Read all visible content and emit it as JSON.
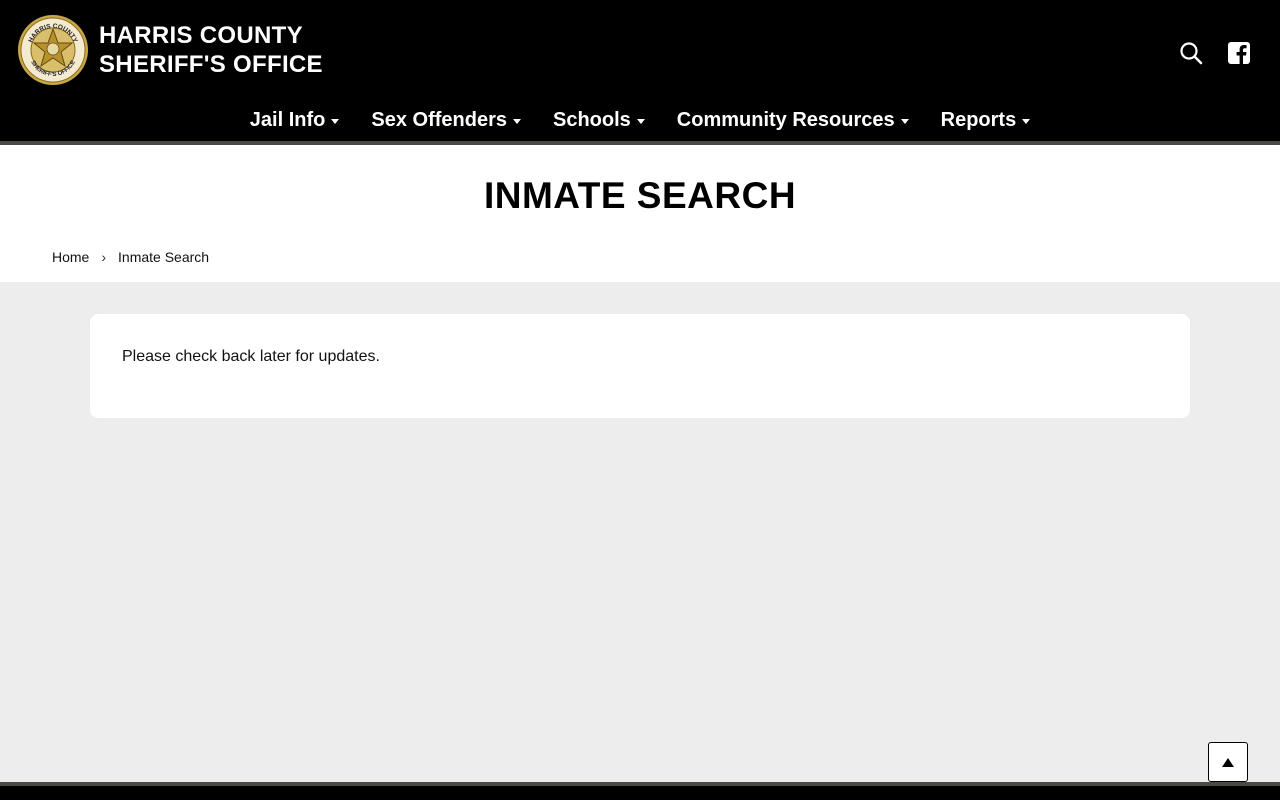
{
  "header": {
    "site_name_line1": "HARRIS COUNTY",
    "site_name_line2": "SHERIFF'S OFFICE",
    "badge": {
      "top_text": "HARRIS COUNTY",
      "bottom_text": "SHERIFF'S OFFICE"
    },
    "icons": [
      "search-icon",
      "facebook-icon"
    ]
  },
  "nav": {
    "items": [
      {
        "label": "Jail Info"
      },
      {
        "label": "Sex Offenders"
      },
      {
        "label": "Schools"
      },
      {
        "label": "Community Resources"
      },
      {
        "label": "Reports"
      }
    ]
  },
  "page": {
    "title": "INMATE SEARCH",
    "breadcrumb": {
      "home": "Home",
      "separator": "›",
      "current": "Inmate Search"
    },
    "message": "Please check back later for updates."
  },
  "colors": {
    "header_bg": "#000000",
    "stripe": "#4a4a44",
    "content_bg": "#ededed",
    "badge_gold": "#c9a646"
  }
}
